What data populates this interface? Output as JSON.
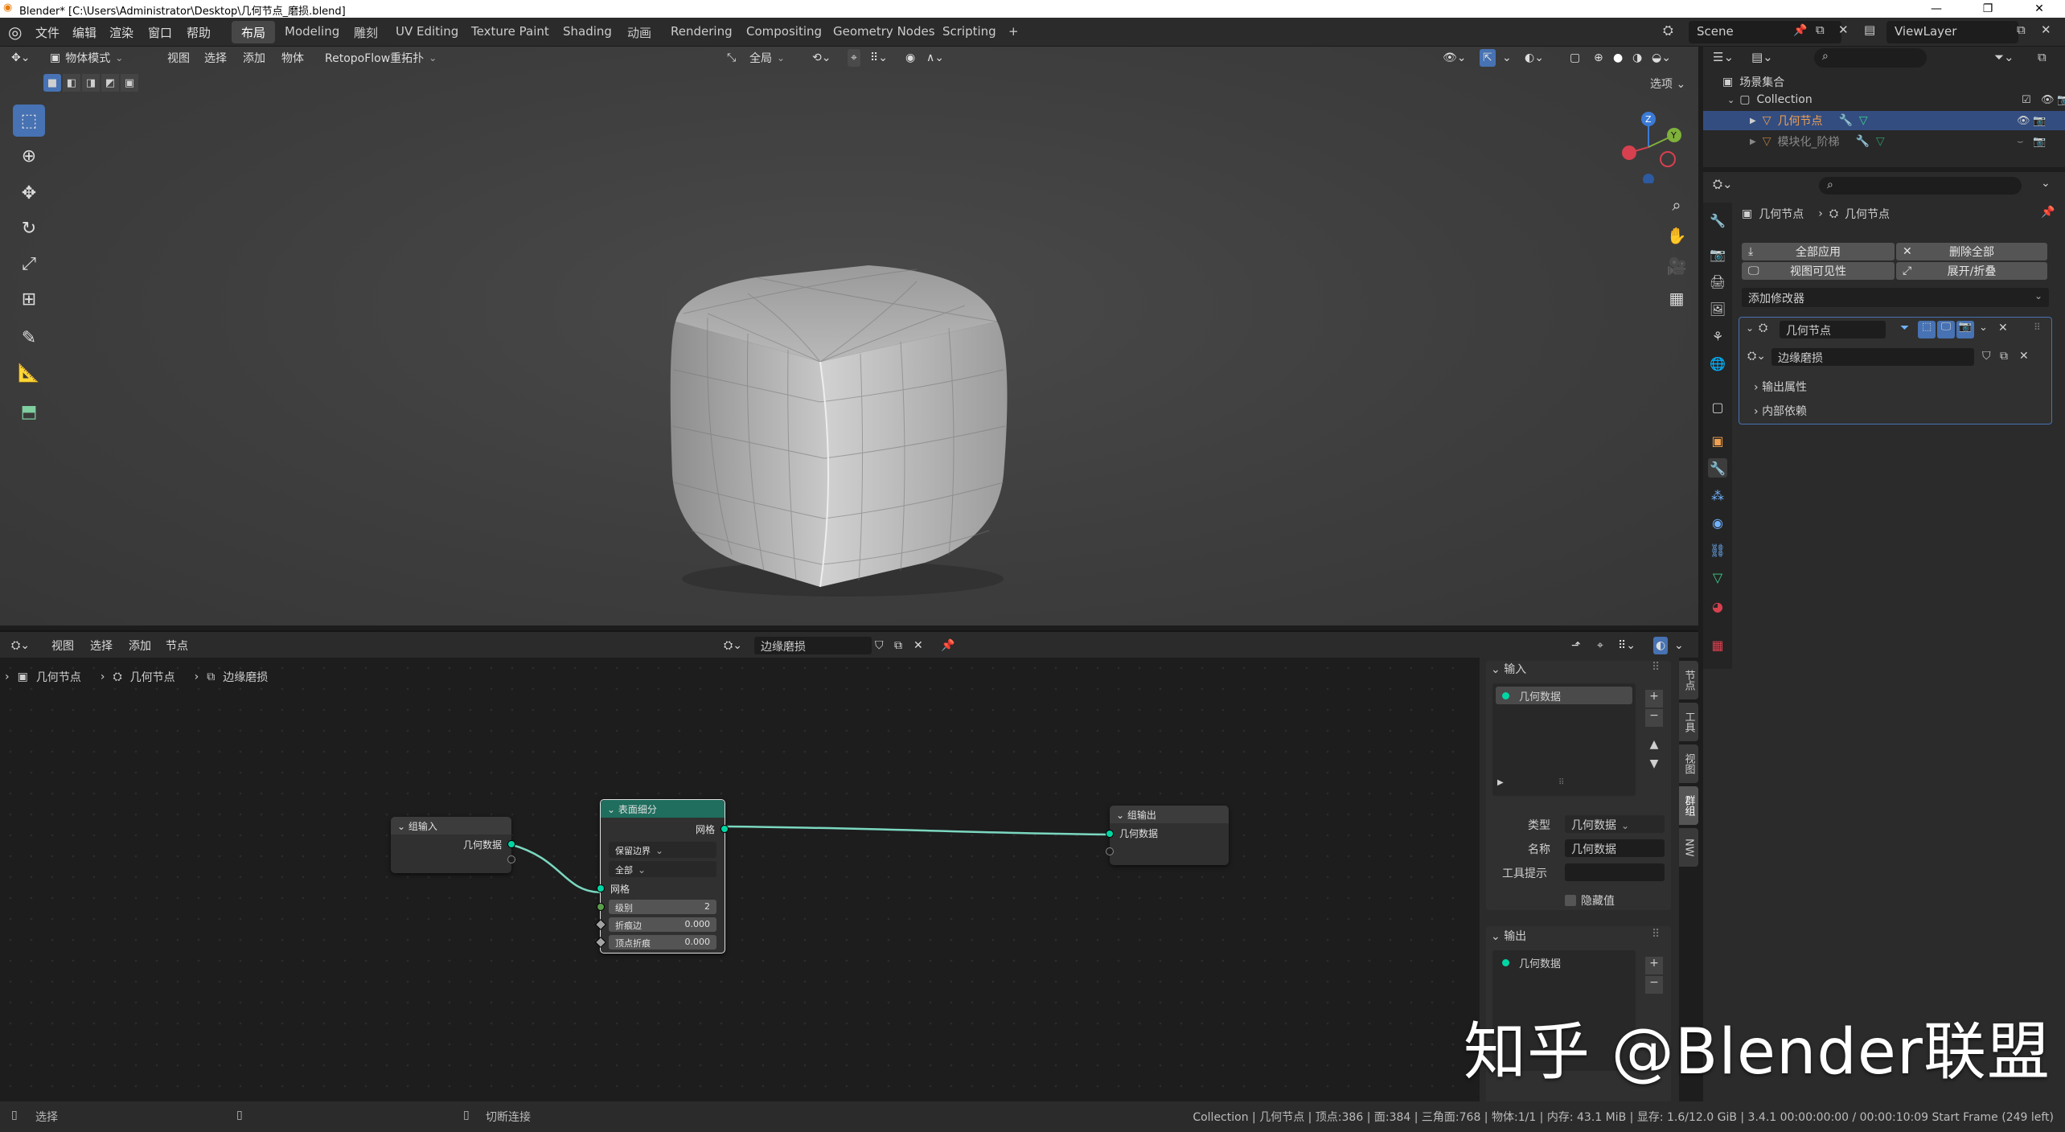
{
  "window": {
    "title": "Blender* [C:\\Users\\Administrator\\Desktop\\几何节点_磨损.blend]",
    "minimize": "—",
    "maximize": "❐",
    "close": "✕"
  },
  "menu": {
    "items": [
      "文件",
      "编辑",
      "渲染",
      "窗口",
      "帮助"
    ]
  },
  "workspaces": {
    "tabs": [
      "布局",
      "Modeling",
      "雕刻",
      "UV Editing",
      "Texture Paint",
      "Shading",
      "动画",
      "Rendering",
      "Compositing",
      "Geometry Nodes",
      "Scripting"
    ],
    "active": "布局",
    "add": "+"
  },
  "scene": {
    "scene_name": "Scene",
    "view_layer": "ViewLayer"
  },
  "viewport": {
    "mode": "物体模式",
    "menus": [
      "视图",
      "选择",
      "添加",
      "物体"
    ],
    "addon": "RetopoFlow重拓扑",
    "transform_orientation": "全局",
    "options": "选项",
    "gizmo_z": "Z",
    "gizmo_y": "Y",
    "gizmo_x": "X"
  },
  "tools": [
    "select-box",
    "cursor",
    "move",
    "rotate",
    "scale",
    "transform",
    "annotate",
    "measure",
    "add-cube"
  ],
  "outliner": {
    "root": "场景集合",
    "collection": "Collection",
    "items": [
      {
        "name": "几何节点",
        "selected": true
      },
      {
        "name": "模块化_阶梯",
        "selected": false
      }
    ]
  },
  "properties": {
    "breadcrumb_object": "几何节点",
    "breadcrumb_modifier": "几何节点",
    "apply_all": "全部应用",
    "delete_all": "删除全部",
    "viewport_vis": "视图可见性",
    "expand_collapse": "展开/折叠",
    "add_modifier": "添加修改器",
    "modifier_name": "几何节点",
    "node_group": "边缘磨损",
    "output_attributes": "输出属性",
    "internal_deps": "内部依赖"
  },
  "node_editor": {
    "menus": [
      "视图",
      "选择",
      "添加",
      "节点"
    ],
    "node_group": "边缘磨损",
    "breadcrumb": [
      "几何节点",
      "几何节点",
      "边缘磨损"
    ],
    "nodes": {
      "group_input": {
        "title": "组输入",
        "socket": "几何数据"
      },
      "subdivision": {
        "title": "表面细分",
        "out_socket": "网格",
        "uv_smooth": "保留边界",
        "boundary": "全部",
        "in_socket": "网格",
        "level_label": "级别",
        "level_value": "2",
        "edge_crease_label": "折痕边",
        "edge_crease_value": "0.000",
        "vertex_crease_label": "顶点折痕",
        "vertex_crease_value": "0.000"
      },
      "group_output": {
        "title": "组输出",
        "socket": "几何数据"
      }
    },
    "side_tabs": [
      "节点",
      "工具",
      "视图",
      "群组",
      "NW"
    ],
    "side_panel": {
      "input_header": "输入",
      "input_item": "几何数据",
      "type_label": "类型",
      "type_value": "几何数据",
      "name_label": "名称",
      "name_value": "几何数据",
      "tooltip_label": "工具提示",
      "hide_value": "隐藏值",
      "output_header": "输出",
      "output_item": "几何数据"
    }
  },
  "status": {
    "left_action": "选择",
    "middle_action": "切断连接",
    "info": "Collection | 几何节点 | 顶点:386 | 面:384 | 三角面:768 | 物体:1/1 | 内存: 43.1 MiB | 显存: 1.6/12.0 GiB | 3.4.1  00:00:00:00 / 00:00:10:09  Start Frame (249 left)"
  },
  "watermark": "知乎 @Blender联盟",
  "colors": {
    "accent": "#4772b3",
    "geometry_socket": "#00d6a3",
    "subdivision_header": "#1f6e5e",
    "selection_orange": "#f0a050"
  }
}
